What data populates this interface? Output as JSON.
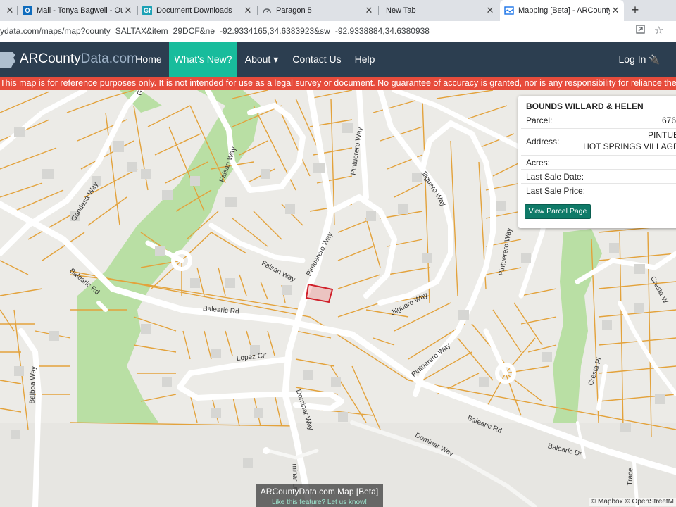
{
  "browser": {
    "tabs": [
      {
        "title": "Mail - Tonya Bagwell - Outl",
        "icon": "outlook-icon",
        "color": "#0f6cbd"
      },
      {
        "title": "Document Downloads",
        "icon": "gf-icon",
        "color": "#1ba1b5"
      },
      {
        "title": "Paragon 5",
        "icon": "gauge-icon",
        "color": "#5f6368"
      },
      {
        "title": "New Tab",
        "icon": "",
        "color": ""
      },
      {
        "title": "Mapping [Beta] - ARCounty",
        "icon": "map-tab-icon",
        "color": "#1a73e8"
      }
    ],
    "new_tab": "+",
    "close": "✕",
    "url": "ydata.com/maps/map?county=SALTAX&item=29DCF&ne=-92.9334165,34.6383923&sw=-92.9338884,34.6380938"
  },
  "site": {
    "brand": "ARCounty",
    "brand_suffix": "Data.com",
    "nav": [
      "Home",
      "What's New?",
      "About ▾",
      "Contact Us",
      "Help"
    ],
    "login": "Log In",
    "disclaimer": "This map is for reference purposes only. It is not intended for use as a legal survey or document. No guarantee of accuracy is granted, nor is any responsibility for reliance thereon as"
  },
  "map": {
    "streets": {
      "faisan_way_a": "Faisan Way",
      "faisan_way_b": "Faisan Way",
      "pintuerero_a": "Pintuerero Way",
      "pintuerero_b": "Pintuerero Way",
      "pintuerero_c": "Pintuerero Way",
      "pintuerero_d": "Pintuerero Way",
      "jilguero_a": "Jilguero Way",
      "jilguero_b": "Jilguero Way",
      "gandesa": "Gandesa Way",
      "balearic_a": "Balearic Rd",
      "balearic_b": "Balearic Rd",
      "balearic_c": "Balearic Rd",
      "balearic_d": "Balearic Dr",
      "lopez": "Lopez Cir",
      "dominar_a": "Dominar Way",
      "dominar_b": "Dominar Way",
      "balboa": "Balboa Way",
      "cresta_way": "Cresta W",
      "cresta_pl": "Cresta Pl",
      "dominar_ln": "minar Ln",
      "trace": "Trace",
      "g": "G"
    },
    "overlay_title": "ARCountyData.com Map [Beta]",
    "overlay_link": "Like this feature? Let us know!",
    "attribution": "© Mapbox © OpenStreetM"
  },
  "popup": {
    "owner": "BOUNDS WILLARD & HELEN",
    "parcel_label": "Parcel:",
    "parcel_value": "676-",
    "address_label": "Address:",
    "address_line1": "PINTUE",
    "address_line2": "HOT SPRINGS VILLAGE",
    "acres_label": "Acres:",
    "sale_date_label": "Last Sale Date:",
    "sale_price_label": "Last Sale Price:",
    "button": "View Parcel Page"
  },
  "colors": {
    "nav_bg": "#2c3e50",
    "nav_active": "#18bc9c",
    "warning": "#e74c3c",
    "parcel_line": "#e3a23b",
    "selected_parcel": "#d0202a",
    "green": "#b9dfa4"
  }
}
